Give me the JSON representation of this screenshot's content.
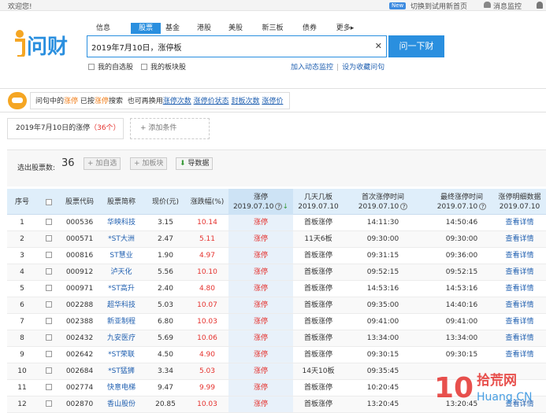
{
  "topbar": {
    "welcome": "欢迎您!",
    "new_badge": "New",
    "switch_link": "切换到试用新首页",
    "messages": "消息监控"
  },
  "nav_tabs": [
    "信息",
    "股票",
    "基金",
    "港股",
    "美股",
    "新三板",
    "债券",
    "更多▸"
  ],
  "active_tab": "股票",
  "search": {
    "value": "2019年7月10日，涨停板",
    "button": "问一下财"
  },
  "options": {
    "my_stocks": "我的自选股",
    "my_blocks": "我的板块股",
    "add_alert": "加入动态监控",
    "save_question": "设为收藏问句"
  },
  "info": {
    "prefix": "问句中的",
    "term1": "涨停",
    "mid": "已按",
    "term2": "涨停",
    "suffix": "搜索",
    "alt_prefix": "也可再换用",
    "alts": [
      "涨停次数",
      "涨停价状态",
      "封板次数",
      "涨停价"
    ]
  },
  "query_chip": {
    "label": "2019年7月10日的涨停",
    "count": "（36个）"
  },
  "add_condition": "+ 添加条件",
  "count_bar": {
    "label": "选出股票数:",
    "count": "36",
    "btn_watch": "+ 加自选",
    "btn_block": "+ 加板块",
    "btn_export": "导数据"
  },
  "headers": {
    "seq": "序号",
    "code": "股票代码",
    "name": "股票简称",
    "price": "现价(元)",
    "change": "涨跌幅(%)",
    "limit": "涨停",
    "limit_date": "2019.07.10",
    "days": "几天几板",
    "days_date": "2019.07.10",
    "first_time": "首次涨停时间",
    "first_date": "2019.07.10",
    "last_time": "最终涨停时间",
    "last_date": "2019.07.10",
    "detail": "涨停明细数据",
    "detail_date": "2019.07.10"
  },
  "rows": [
    {
      "seq": "1",
      "code": "000536",
      "name": "华映科技",
      "price": "3.15",
      "change": "10.14",
      "limit": "涨停",
      "days": "首板涨停",
      "first": "14:11:30",
      "last": "14:50:46",
      "detail": "查看详情"
    },
    {
      "seq": "2",
      "code": "000571",
      "name": "*ST大洲",
      "price": "2.47",
      "change": "5.11",
      "limit": "涨停",
      "days": "11天6板",
      "first": "09:30:00",
      "last": "09:30:00",
      "detail": "查看详情"
    },
    {
      "seq": "3",
      "code": "000816",
      "name": "ST慧业",
      "price": "1.90",
      "change": "4.97",
      "limit": "涨停",
      "days": "首板涨停",
      "first": "09:31:15",
      "last": "09:36:00",
      "detail": "查看详情"
    },
    {
      "seq": "4",
      "code": "000912",
      "name": "泸天化",
      "price": "5.56",
      "change": "10.10",
      "limit": "涨停",
      "days": "首板涨停",
      "first": "09:52:15",
      "last": "09:52:15",
      "detail": "查看详情"
    },
    {
      "seq": "5",
      "code": "000971",
      "name": "*ST高升",
      "price": "2.40",
      "change": "4.80",
      "limit": "涨停",
      "days": "首板涨停",
      "first": "14:53:16",
      "last": "14:53:16",
      "detail": "查看详情"
    },
    {
      "seq": "6",
      "code": "002288",
      "name": "超华科技",
      "price": "5.03",
      "change": "10.07",
      "limit": "涨停",
      "days": "首板涨停",
      "first": "09:35:00",
      "last": "14:40:16",
      "detail": "查看详情"
    },
    {
      "seq": "7",
      "code": "002388",
      "name": "新亚制程",
      "price": "6.80",
      "change": "10.03",
      "limit": "涨停",
      "days": "首板涨停",
      "first": "09:41:00",
      "last": "09:41:00",
      "detail": "查看详情"
    },
    {
      "seq": "8",
      "code": "002432",
      "name": "九安医疗",
      "price": "5.69",
      "change": "10.06",
      "limit": "涨停",
      "days": "首板涨停",
      "first": "13:34:00",
      "last": "13:34:00",
      "detail": "查看详情"
    },
    {
      "seq": "9",
      "code": "002642",
      "name": "*ST荣联",
      "price": "4.50",
      "change": "4.90",
      "limit": "涨停",
      "days": "首板涨停",
      "first": "09:30:15",
      "last": "09:30:15",
      "detail": "查看详情"
    },
    {
      "seq": "10",
      "code": "002684",
      "name": "*ST猛狮",
      "price": "3.34",
      "change": "5.03",
      "limit": "涨停",
      "days": "14天10板",
      "first": "09:35:45",
      "last": "",
      "detail": ""
    },
    {
      "seq": "11",
      "code": "002774",
      "name": "快意电梯",
      "price": "9.47",
      "change": "9.99",
      "limit": "涨停",
      "days": "首板涨停",
      "first": "10:20:45",
      "last": "",
      "detail": ""
    },
    {
      "seq": "12",
      "code": "002870",
      "name": "香山股份",
      "price": "20.85",
      "change": "10.03",
      "limit": "涨停",
      "days": "首板涨停",
      "first": "13:20:45",
      "last": "13:20:45",
      "detail": "查看详情"
    }
  ],
  "watermark": {
    "big": "10",
    "brand": "拾荒网",
    "domain": "Huang.CN"
  },
  "colors": {
    "accent": "#2a8fdf",
    "red": "#e5322e",
    "orange": "#f07e1a",
    "link": "#1f5fb0"
  }
}
